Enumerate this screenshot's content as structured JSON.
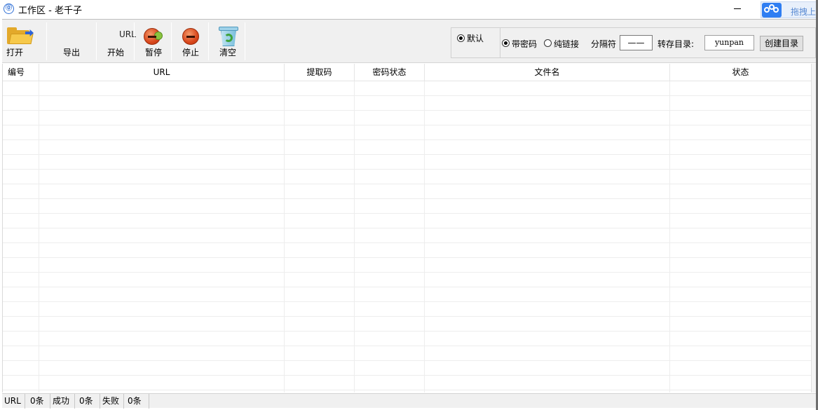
{
  "window": {
    "title": "工作区 - 老千子",
    "extension_label": "拖拽上传"
  },
  "toolbar": {
    "url_tag": "URL",
    "buttons": [
      {
        "id": "open",
        "label": "打开",
        "icon": "folder-icon"
      },
      {
        "id": "export",
        "label": "导出",
        "icon": "export-icon"
      },
      {
        "id": "start",
        "label": "开始",
        "icon": "play-icon"
      },
      {
        "id": "pause",
        "label": "暂停",
        "icon": "pause-icon"
      },
      {
        "id": "stop",
        "label": "停止",
        "icon": "stop-icon"
      },
      {
        "id": "clear",
        "label": "清空",
        "icon": "recycle-bin-icon"
      }
    ]
  },
  "options": {
    "default_label": "默认",
    "default_selected": true,
    "with_password_label": "带密码",
    "with_password_selected": true,
    "pure_link_label": "纯链接",
    "pure_link_selected": false,
    "separator_label": "分隔符",
    "separator_value": "——",
    "save_dir_label": "转存目录:",
    "save_dir_value": "yunpan",
    "create_dir_button": "创建目录"
  },
  "table": {
    "columns": [
      "编号",
      "URL",
      "提取码",
      "密码状态",
      "文件名",
      "状态"
    ],
    "rows": []
  },
  "status_bar": {
    "url_label": "URL",
    "url_count": "0条",
    "success_label": "成功",
    "success_count": "0条",
    "fail_label": "失败",
    "fail_count": "0条"
  },
  "colors": {
    "toolbar_bg": "#f0f0f0",
    "accent_blue": "#2f7ef2",
    "stop_red": "#d9471c",
    "folder_yellow": "#f6c94b"
  }
}
